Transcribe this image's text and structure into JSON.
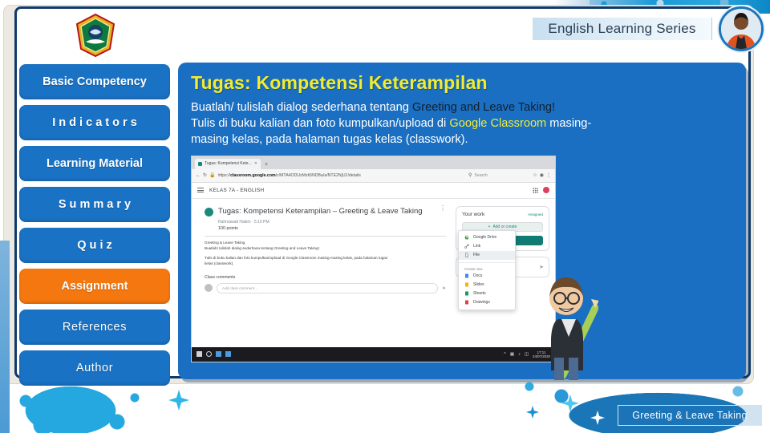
{
  "header": {
    "title": "English Learning Series",
    "logo_name": "school-emblem-logo",
    "avatar_name": "teacher-avatar"
  },
  "sidebar": {
    "items": [
      {
        "label": "Basic Competency",
        "style": "normal",
        "active": false
      },
      {
        "label": "I n d i c a t o r s",
        "style": "normal",
        "active": false
      },
      {
        "label": "Learning Material",
        "style": "normal",
        "active": false
      },
      {
        "label": "S u m m a r y",
        "style": "normal",
        "active": false
      },
      {
        "label": "Q u i z",
        "style": "normal",
        "active": false
      },
      {
        "label": "Assignment",
        "style": "normal",
        "active": true
      },
      {
        "label": "References",
        "style": "plain",
        "active": false
      },
      {
        "label": "Author",
        "style": "plain",
        "active": false
      }
    ]
  },
  "content": {
    "title": "Tugas: Kompetensi Keterampilan",
    "line1_a": "Buatlah/ tulislah dialog sederhana tentang ",
    "line1_b": "Greeting and Leave Taking!",
    "line2_a": "Tulis di buku kalian dan foto kumpulkan/upload di ",
    "line2_b": "Google Classroom",
    "line2_c": " masing-",
    "line3": "masing kelas, pada halaman tugas kelas  (classwork)."
  },
  "screenshot": {
    "browser_tab": "Tugas: Kompetensi Kete...",
    "new_tab_label": "+",
    "url": "https://classroom.google.com/c/MTA4ODUzMzk5NDBa/a/NTE2NjU1/details",
    "url_domain": "classroom.google.com",
    "search_placeholder": "Search",
    "app_title": "KELAS 7A - ENGLISH",
    "assignment_title": "Tugas: Kompetensi Keterampilan – Greeting & Leave Taking",
    "assignment_meta": "Rahmawati Hakim · 5:10 PM",
    "assignment_points": "100 points",
    "desc_line1": "Greeting & Leave Taking",
    "desc_line2": "Buatlah/ tulislah dialog sederhana tentang Greeting and Leave Taking!",
    "desc_line3": "Tulis di buku kalian dan foto kumpulkan/upload di Google Classroom masing-masing kelas, pada halaman tugas",
    "desc_line4": "kelas (classwork).",
    "comments_label": "Class comments",
    "comment_placeholder": "Add class comment...",
    "your_work_title": "Your work",
    "your_work_status": "Assigned",
    "add_create_label": "Add or create",
    "menu_items": [
      {
        "label": "Google Drive",
        "icon": "drive-icon"
      },
      {
        "label": "Link",
        "icon": "link-icon"
      },
      {
        "label": "File",
        "icon": "file-icon"
      }
    ],
    "menu_group_label": "Create new",
    "menu_create_items": [
      {
        "label": "Docs",
        "icon": "docs-icon"
      },
      {
        "label": "Slides",
        "icon": "slides-icon"
      },
      {
        "label": "Sheets",
        "icon": "sheets-icon"
      },
      {
        "label": "Drawings",
        "icon": "drawings-icon"
      }
    ],
    "taskbar_time": "17:11",
    "taskbar_date": "24/07/2020"
  },
  "footer": {
    "chip_label": "Greeting & Leave Taking"
  },
  "colors": {
    "nav_blue": "#1a72c4",
    "nav_active_orange": "#f4780f",
    "panel_blue": "#1b6fc2",
    "title_yellow": "#f2ec30",
    "frame_navy": "#103a6b",
    "splash_cyan": "#25a8df"
  }
}
